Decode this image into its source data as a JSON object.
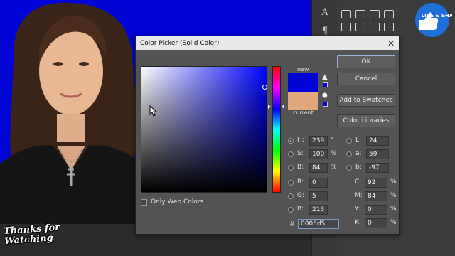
{
  "dialog": {
    "title": "Color Picker (Solid Color)",
    "close_icon": "close-x-icon",
    "new_label": "new",
    "current_label": "current",
    "new_color": "#0005d5",
    "current_color": "#e1a67b",
    "buttons": {
      "ok": "OK",
      "cancel": "Cancel",
      "add_to_swatches": "Add to Swatches",
      "color_libraries": "Color Libraries"
    },
    "hsb": {
      "h_label": "H:",
      "h_value": "239",
      "h_unit": "°",
      "s_label": "S:",
      "s_value": "100",
      "s_unit": "%",
      "b_label": "B:",
      "b_value": "84",
      "b_unit": "%"
    },
    "rgb": {
      "r_label": "R:",
      "r_value": "0",
      "g_label": "G:",
      "g_value": "5",
      "b_label": "B:",
      "b_value": "213"
    },
    "lab": {
      "l_label": "L:",
      "l_value": "24",
      "a_label": "a:",
      "a_value": "59",
      "b_label": "b:",
      "b_value": "-97"
    },
    "cmyk": {
      "c_label": "C:",
      "c_value": "92",
      "c_unit": "%",
      "m_label": "M:",
      "m_value": "84",
      "m_unit": "%",
      "y_label": "Y:",
      "y_value": "0",
      "y_unit": "%",
      "k_label": "K:",
      "k_value": "0",
      "k_unit": "%"
    },
    "hex_hash": "#",
    "hex_value": "0005d5",
    "only_web_colors": "Only Web Colors"
  },
  "overlay": {
    "thanks_text": "Thanks for Watching",
    "like_share_text": "LIKE & SHARE"
  },
  "colors": {
    "canvas_background": "#0005d5",
    "panel_background": "#3c3c3c",
    "dialog_background": "#535353"
  }
}
